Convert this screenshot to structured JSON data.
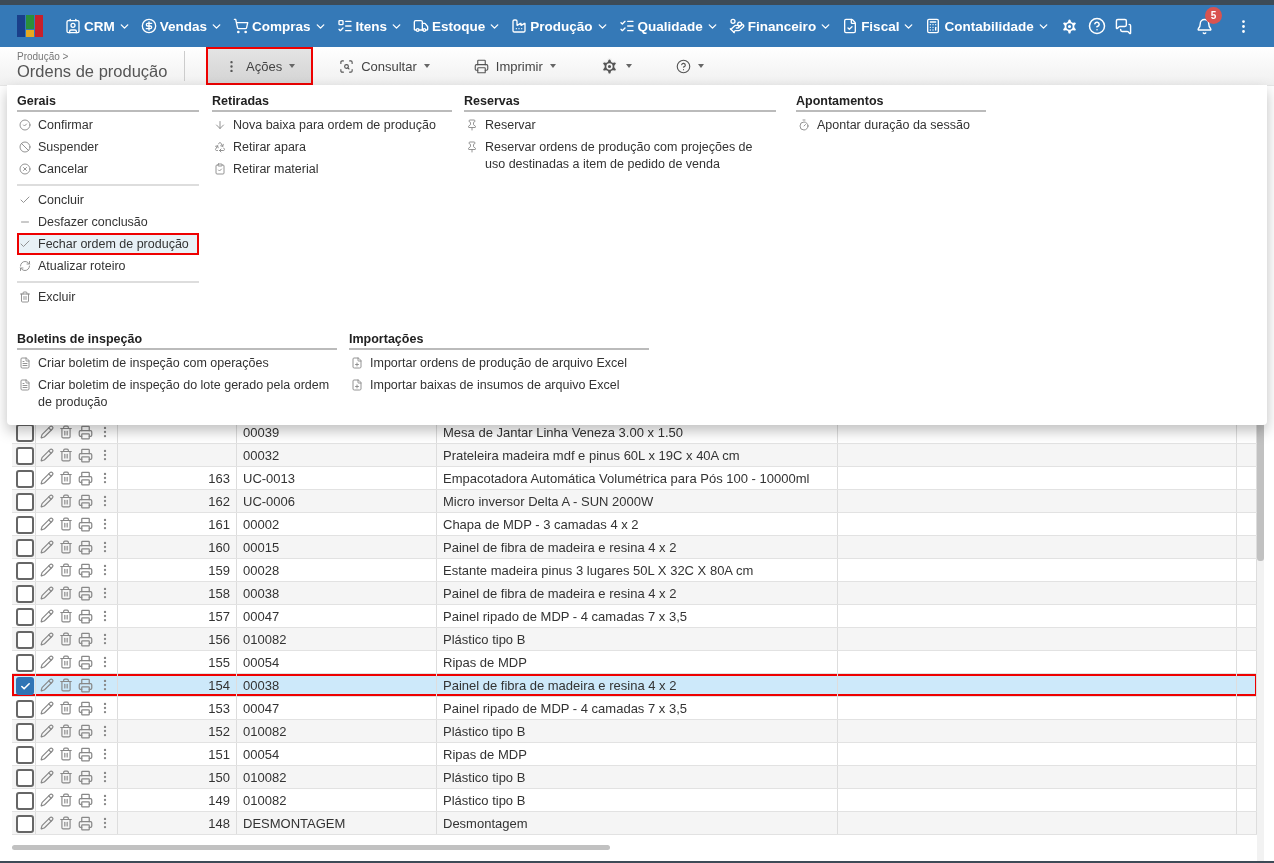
{
  "nav": {
    "items": [
      {
        "label": "CRM",
        "kind": "crm"
      },
      {
        "label": "Vendas",
        "kind": "vendas"
      },
      {
        "label": "Compras",
        "kind": "compras"
      },
      {
        "label": "Itens",
        "kind": "itens"
      },
      {
        "label": "Estoque",
        "kind": "estoque"
      },
      {
        "label": "Produção",
        "kind": "producao"
      },
      {
        "label": "Qualidade",
        "kind": "qualidade"
      },
      {
        "label": "Financeiro",
        "kind": "financeiro"
      },
      {
        "label": "Fiscal",
        "kind": "fiscal"
      },
      {
        "label": "Contabilidade",
        "kind": "contabilidade"
      }
    ],
    "notifications": "5"
  },
  "toolbar": {
    "breadcrumb": "Produção >",
    "title": "Ordens de produção",
    "buttons": [
      {
        "kind": "dots",
        "label": "Ações",
        "pressed": true,
        "marked": true
      },
      {
        "kind": "search",
        "label": "Consultar",
        "pressed": false,
        "marked": false
      },
      {
        "kind": "print",
        "label": "Imprimir",
        "pressed": false,
        "marked": false
      },
      {
        "kind": "gear",
        "pressed": false,
        "marked": false
      },
      {
        "kind": "help",
        "pressed": false,
        "marked": false
      }
    ]
  },
  "menu": {
    "rows": [
      {
        "sections": [
          {
            "title": "Gerais",
            "groups": [
              {
                "items": [
                  {
                    "label": "Confirmar",
                    "kind": "confirm",
                    "hovered": false,
                    "marked": false
                  },
                  {
                    "label": "Suspender",
                    "kind": "suspend",
                    "hovered": false,
                    "marked": false
                  },
                  {
                    "label": "Cancelar",
                    "kind": "cancel",
                    "hovered": false,
                    "marked": false
                  }
                ]
              },
              {
                "items": [
                  {
                    "label": "Concluir",
                    "kind": "check",
                    "hovered": false,
                    "marked": false
                  },
                  {
                    "label": "Desfazer conclusão",
                    "kind": "minus",
                    "hovered": false,
                    "marked": false
                  },
                  {
                    "label": "Fechar ordem de produção",
                    "kind": "check",
                    "hovered": true,
                    "marked": true
                  },
                  {
                    "label": "Atualizar roteiro",
                    "kind": "refresh",
                    "hovered": false,
                    "marked": false
                  }
                ]
              },
              {
                "items": [
                  {
                    "label": "Excluir",
                    "kind": "trash",
                    "hovered": false,
                    "marked": false
                  }
                ]
              }
            ]
          },
          {
            "title": "Retiradas",
            "groups": [
              {
                "items": [
                  {
                    "label": "Nova baixa para ordem de produção",
                    "kind": "down",
                    "hovered": false,
                    "marked": false
                  },
                  {
                    "label": "Retirar apara",
                    "kind": "recycle",
                    "hovered": false,
                    "marked": false
                  },
                  {
                    "label": "Retirar material",
                    "kind": "clipboard",
                    "hovered": false,
                    "marked": false
                  }
                ]
              }
            ]
          },
          {
            "title": "Reservas",
            "groups": [
              {
                "items": [
                  {
                    "label": "Reservar",
                    "kind": "pin",
                    "hovered": false,
                    "marked": false
                  },
                  {
                    "label": "Reservar ordens de produção com projeções de uso destinadas a item de pedido de venda",
                    "kind": "pin",
                    "hovered": false,
                    "marked": false
                  }
                ]
              }
            ]
          },
          {
            "title": "Apontamentos",
            "groups": [
              {
                "items": [
                  {
                    "label": "Apontar duração da sessão",
                    "kind": "timer",
                    "hovered": false,
                    "marked": false
                  }
                ]
              }
            ]
          }
        ]
      },
      {
        "sections": [
          {
            "title": "Boletins de inspeção",
            "groups": [
              {
                "items": [
                  {
                    "label": "Criar boletim de inspeção com operações",
                    "kind": "doc",
                    "hovered": false,
                    "marked": false
                  },
                  {
                    "label": "Criar boletim de inspeção do lote gerado pela ordem de produção",
                    "kind": "doc",
                    "hovered": false,
                    "marked": false
                  }
                ]
              }
            ]
          },
          {
            "title": "Importações",
            "groups": [
              {
                "items": [
                  {
                    "label": "Importar ordens de produção de arquivo Excel",
                    "kind": "import",
                    "hovered": false,
                    "marked": false
                  },
                  {
                    "label": "Importar baixas de insumos de arquivo Excel",
                    "kind": "import",
                    "hovered": false,
                    "marked": false
                  }
                ]
              }
            ]
          }
        ]
      }
    ]
  },
  "table": {
    "rows": [
      {
        "number": "",
        "code": "00039",
        "description": "Mesa de Jantar Linha Veneza 3.00 x 1.50",
        "checked": false,
        "marked": false
      },
      {
        "number": "",
        "code": "00032",
        "description": "Prateleira madeira mdf e pinus 60L x 19C x 40A cm",
        "checked": false,
        "marked": false
      },
      {
        "number": "163",
        "code": "UC-0013",
        "description": "Empacotadora Automática Volumétrica para Pós 100 - 10000ml",
        "checked": false,
        "marked": false
      },
      {
        "number": "162",
        "code": "UC-0006",
        "description": "Micro inversor Delta A - SUN 2000W",
        "checked": false,
        "marked": false
      },
      {
        "number": "161",
        "code": "00002",
        "description": "Chapa de MDP - 3 camadas 4 x 2",
        "checked": false,
        "marked": false
      },
      {
        "number": "160",
        "code": "00015",
        "description": "Painel de fibra de madeira e resina 4 x 2",
        "checked": false,
        "marked": false
      },
      {
        "number": "159",
        "code": "00028",
        "description": "Estante madeira pinus 3 lugares 50L X 32C X 80A cm",
        "checked": false,
        "marked": false
      },
      {
        "number": "158",
        "code": "00038",
        "description": "Painel de fibra de madeira e resina 4 x 2",
        "checked": false,
        "marked": false
      },
      {
        "number": "157",
        "code": "00047",
        "description": "Painel ripado de MDP - 4 camadas 7 x 3,5",
        "checked": false,
        "marked": false
      },
      {
        "number": "156",
        "code": "010082",
        "description": "Plástico tipo B",
        "checked": false,
        "marked": false
      },
      {
        "number": "155",
        "code": "00054",
        "description": "Ripas de MDP",
        "checked": false,
        "marked": false
      },
      {
        "number": "154",
        "code": "00038",
        "description": "Painel de fibra de madeira e resina 4 x 2",
        "checked": true,
        "marked": true
      },
      {
        "number": "153",
        "code": "00047",
        "description": "Painel ripado de MDP - 4 camadas 7 x 3,5",
        "checked": false,
        "marked": false
      },
      {
        "number": "152",
        "code": "010082",
        "description": "Plástico tipo B",
        "checked": false,
        "marked": false
      },
      {
        "number": "151",
        "code": "00054",
        "description": "Ripas de MDP",
        "checked": false,
        "marked": false
      },
      {
        "number": "150",
        "code": "010082",
        "description": "Plástico tipo B",
        "checked": false,
        "marked": false
      },
      {
        "number": "149",
        "code": "010082",
        "description": "Plástico tipo B",
        "checked": false,
        "marked": false
      },
      {
        "number": "148",
        "code": "DESMONTAGEM",
        "description": "Desmontagem",
        "checked": false,
        "marked": false
      }
    ]
  }
}
